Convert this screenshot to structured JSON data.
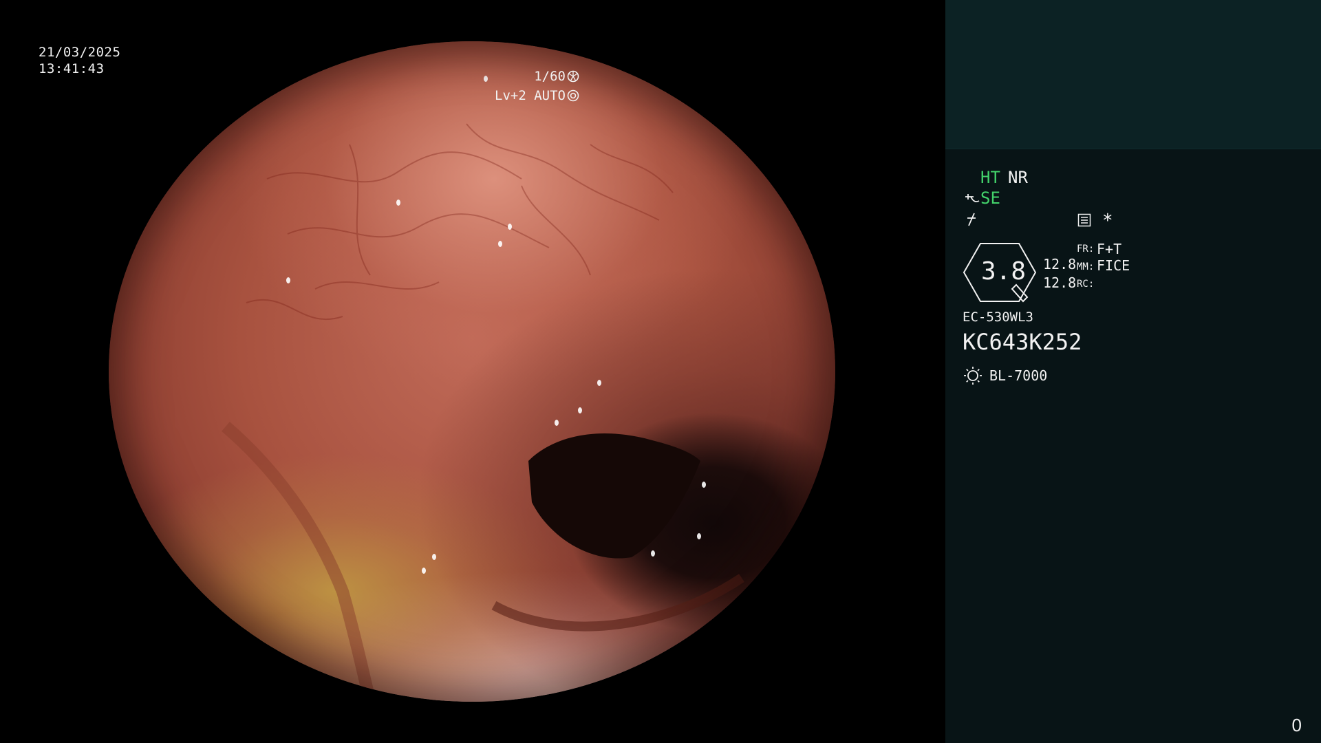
{
  "overlay": {
    "date": "21/03/2025",
    "time": "13:41:43",
    "shutter": "1/60",
    "iris_level": "Lv+2",
    "iris_mode": "AUTO"
  },
  "side_panel": {
    "ht": "HT",
    "nr": "NR",
    "se": "SE",
    "star": "*",
    "zoom": "3.8",
    "value_a": "12.8",
    "value_b": "12.8",
    "fr_label": "FR:",
    "fr_value": "F+T",
    "mm_label": "MM:",
    "mm_value": "FICE",
    "rc_label": "RC:",
    "scope_model": "EC-530WL3",
    "serial": "KC643K252",
    "light_source": "BL-7000",
    "frame_counter": "0"
  },
  "colors": {
    "panel_bg": "#081416",
    "panel_top": "#0c2224",
    "accent_green": "#43d36b",
    "text": "#f2f2f2"
  },
  "icons": [
    "shutter-icon",
    "iris-icon",
    "structure-enhance-icon",
    "color-enhance-icon",
    "menu-icon",
    "lamp-icon"
  ]
}
